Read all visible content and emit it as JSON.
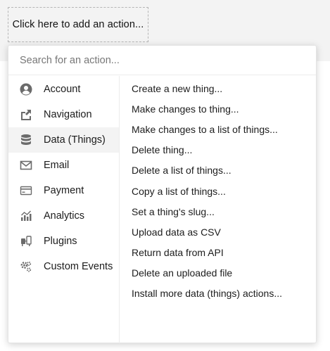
{
  "trigger": {
    "label": "Click here to add an action..."
  },
  "search": {
    "placeholder": "Search for an action..."
  },
  "categories": [
    {
      "label": "Account",
      "icon": "account-icon"
    },
    {
      "label": "Navigation",
      "icon": "navigation-icon"
    },
    {
      "label": "Data (Things)",
      "icon": "database-icon",
      "active": true
    },
    {
      "label": "Email",
      "icon": "email-icon"
    },
    {
      "label": "Payment",
      "icon": "payment-icon"
    },
    {
      "label": "Analytics",
      "icon": "analytics-icon"
    },
    {
      "label": "Plugins",
      "icon": "plugins-icon"
    },
    {
      "label": "Custom Events",
      "icon": "gears-icon"
    }
  ],
  "actions": [
    "Create a new thing...",
    "Make changes to thing...",
    "Make changes to a list of things...",
    "Delete thing...",
    "Delete a list of things...",
    "Copy a list of things...",
    "Set a thing's slug...",
    "Upload data as CSV",
    "Return data from API",
    "Delete an uploaded file",
    "Install more data (things) actions..."
  ],
  "colors": {
    "icon": "#6b6b6b",
    "active_bg": "#f3f3f3",
    "backdrop": "#f3f3f3"
  }
}
